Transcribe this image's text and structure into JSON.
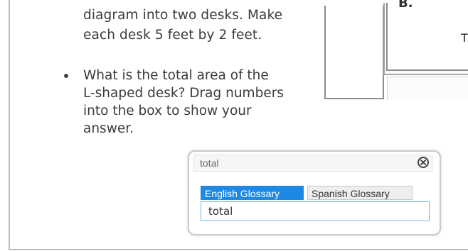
{
  "question": {
    "lines": [
      "diagram into two desks. Make",
      "each desk 5 feet by 2 feet."
    ],
    "bullet_lines": [
      "What is the total area of the",
      "L-shaped desk? Drag numbers",
      "into the box to show your",
      "answer."
    ]
  },
  "diagram": {
    "letter": "B.",
    "edge_char": "T"
  },
  "glossary": {
    "title": "total",
    "tabs": [
      {
        "label": "English Glossary",
        "active": true
      },
      {
        "label": "Spanish Glossary",
        "active": false
      }
    ],
    "content": "total",
    "colors": {
      "active_tab": "#1e88e5",
      "content_border": "#6eb6ef"
    },
    "close_icon": "close-icon"
  }
}
